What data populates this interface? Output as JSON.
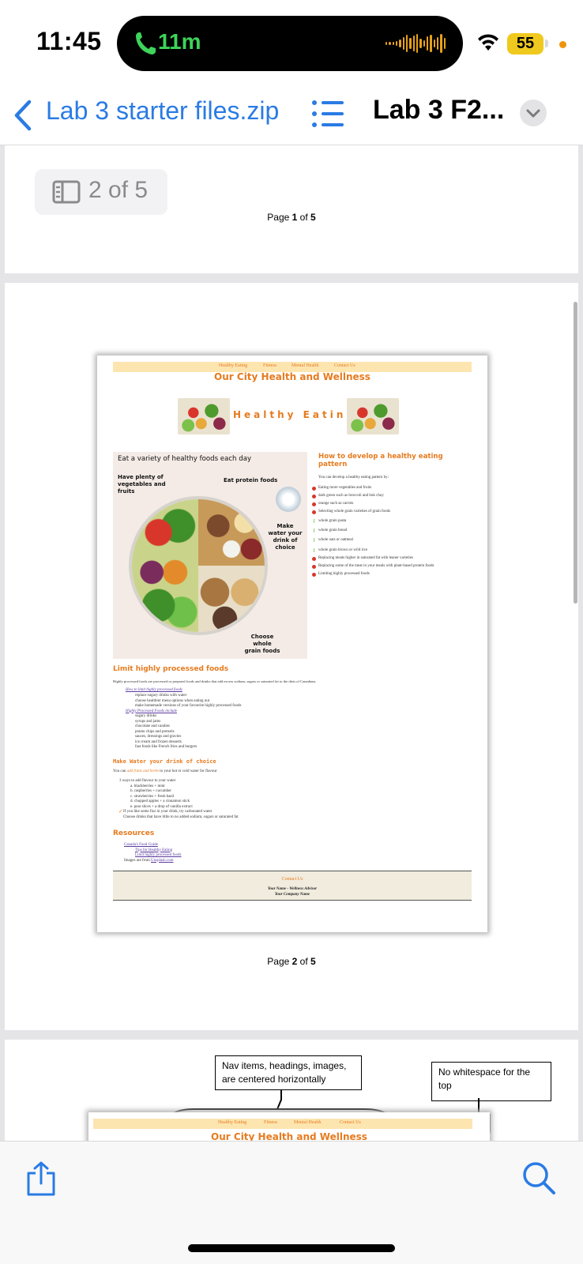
{
  "status_bar": {
    "time": "11:45",
    "call_duration": "11m",
    "battery_level": "55",
    "icons": [
      "phone-icon",
      "waveform-icon",
      "wifi-icon",
      "battery-icon"
    ]
  },
  "nav_bar": {
    "back_label": "Lab 3 starter files.zip",
    "document_title": "Lab 3 F2...",
    "icons": [
      "back-chevron-icon",
      "list-icon",
      "chevron-down-icon"
    ]
  },
  "viewer": {
    "page_counter": "2 of 5",
    "pages": [
      {
        "label_prefix": "Page ",
        "number": "1",
        "label_mid": " of ",
        "total": "5"
      },
      {
        "label_prefix": "Page ",
        "number": "2",
        "label_mid": " of ",
        "total": "5"
      }
    ],
    "page2_content": {
      "nav_items": [
        "Healthy Eating",
        "Fitness",
        "Mental Health",
        "Contact Us"
      ],
      "site_title": "Our City Health and Wellness",
      "banner": "Healthy Eating",
      "plate": {
        "heading": "Eat a variety of healthy foods each day",
        "veg_label": "Have plenty of vegetables and fruits",
        "protein_label": "Eat protein foods",
        "water_label": "Make water your drink of choice",
        "grain_label": "Choose whole grain foods"
      },
      "develop_heading": "How to develop a healthy eating pattern",
      "develop_intro": "You can develop a healthy eating pattern by:",
      "develop_items": [
        "Eating more vegetables and fruits",
        "dark green such as broccoli and bok choy",
        "orange such as carrots",
        "Selecting whole grain varieties of grain foods",
        "whole grain pasta",
        "whole grain bread",
        "whole oats or oatmeal",
        "whole grain brown or wild rice",
        "Replacing meats higher in saturated fat with leaner varieties",
        "Replacing some of the meat in your meals with plant-based protein foods",
        "Limiting highly processed foods"
      ],
      "limit_heading": "Limit highly processed foods",
      "limit_intro": "Highly processed foods are processed or prepared foods and drinks that add excess sodium, sugars or saturated fat to the diets of Canadians.",
      "limit_link1": "How to limit highly processed foods",
      "limit_sub1": [
        "replace sugary drinks with water",
        "choose healthier menu options when eating out",
        "make homemade versions of your favourite highly processed foods"
      ],
      "limit_link2": "Highly Processed Foods include",
      "limit_sub2": [
        "sugary drinks",
        "syrups and jams",
        "chocolate and candies",
        "potato chips and pretzels",
        "sauces, dressings and gravies",
        "ice cream and frozen desserts",
        "fast foods like French fries and burgers"
      ],
      "water_heading": "Make Water your drink of choice",
      "water_intro_start": "You can ",
      "water_intro_em": "add fruits and herbs",
      "water_intro_end": " to your hot or cold water for flavour",
      "water_ways": "3 ways to add flavour to your water",
      "water_list": [
        "a. blackberries + mint",
        "b. raspberries + cucumber",
        "c. strawberries + fresh basil",
        "d. chopped apples + a cinnamon stick",
        "e. pear slices + a drop of vanilla extract"
      ],
      "water_fizz": "If you like some fizz in your drink, try carbonated water",
      "water_choose": "Choose drinks that have little to no added sodium, sugars or saturated fat",
      "resources_heading": "Resources",
      "resources_link": "Canada's Food Guide",
      "resources_sub": [
        "Tips for Healthy Eating",
        "Limit highly processed foods"
      ],
      "resources_images_prefix": "Images are from ",
      "resources_images_link": "Unsplash.com",
      "footer_heading": "Contact Us",
      "footer_name": "Your Name - Wellness Advisor",
      "footer_company": "Your Company Name"
    },
    "page3": {
      "callout1": "Nav items, headings, images, are centered horizontally",
      "callout2": "No whitespace for the top",
      "nav_items": [
        "Healthy Eating",
        "Fitness",
        "Mental Health",
        "Contact Us"
      ],
      "site_title": "Our City Health and Wellness"
    }
  },
  "toolbar": {
    "icons": [
      "share-icon",
      "search-icon"
    ]
  },
  "colors": {
    "accent": "#2a7be4",
    "orange": "#e67b1f",
    "call_green": "#3ed35a",
    "battery_yellow": "#f0c91e"
  }
}
